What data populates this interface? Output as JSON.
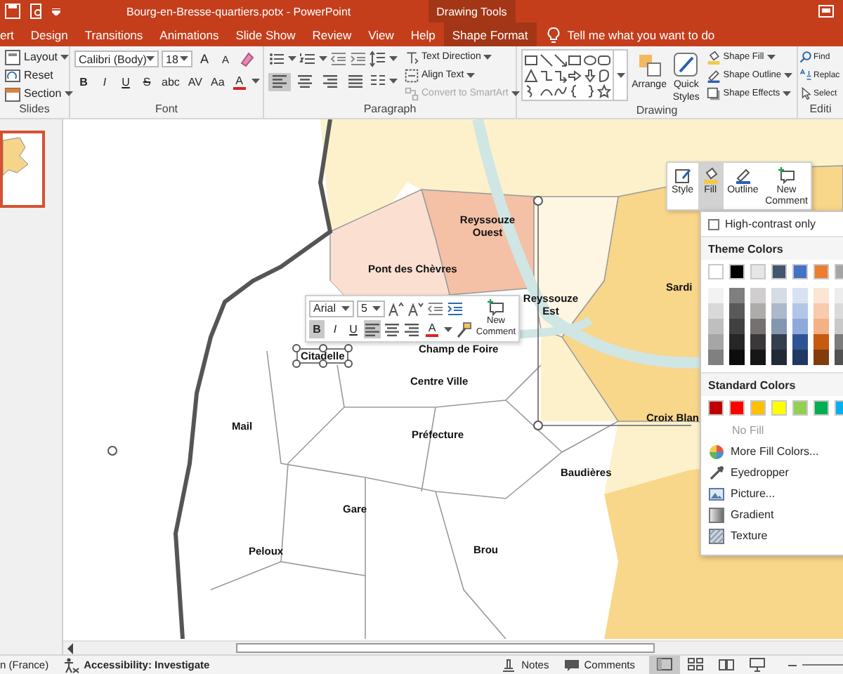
{
  "title_bar": {
    "title": "Bourg-en-Bresse-quartiers.potx  -  PowerPoint",
    "contextual_group": "Drawing Tools"
  },
  "tabs": [
    {
      "label": "ert",
      "selected": false
    },
    {
      "label": "Design",
      "selected": false
    },
    {
      "label": "Transitions",
      "selected": false
    },
    {
      "label": "Animations",
      "selected": false
    },
    {
      "label": "Slide Show",
      "selected": false
    },
    {
      "label": "Review",
      "selected": false
    },
    {
      "label": "View",
      "selected": false
    },
    {
      "label": "Help",
      "selected": false
    },
    {
      "label": "Shape Format",
      "selected": true
    }
  ],
  "tell_me": {
    "placeholder": "Tell me what you want to do"
  },
  "ribbon": {
    "slides_group": {
      "label": "Slides",
      "buttons": [
        {
          "kind": "layout",
          "label": "Layout"
        },
        {
          "kind": "reset",
          "label": "Reset"
        },
        {
          "kind": "section",
          "label": "Section"
        }
      ]
    },
    "font_group": {
      "label": "Font",
      "font": "Calibri (Body)",
      "size": "18",
      "size_buttons": [
        "A",
        "A"
      ],
      "style_buttons": [
        {
          "label": "B",
          "selected": false
        },
        {
          "label": "I",
          "selected": false
        },
        {
          "label": "U",
          "selected": false
        },
        {
          "label": "S",
          "selected": false
        },
        {
          "label": "abc",
          "selected": false
        },
        {
          "label": "AV",
          "selected": false
        },
        {
          "label": "Aa",
          "selected": false
        }
      ],
      "font_color_label": "A"
    },
    "paragraph_group": {
      "label": "Paragraph",
      "align_buttons": [
        {
          "kind": "left",
          "selected": true
        },
        {
          "kind": "center",
          "selected": false
        },
        {
          "kind": "right",
          "selected": false
        },
        {
          "kind": "justify",
          "selected": false
        }
      ],
      "commands": [
        {
          "kind": "text-direction",
          "label": "Text Direction",
          "disabled": false
        },
        {
          "kind": "align-text",
          "label": "Align Text",
          "disabled": false
        },
        {
          "kind": "smartart",
          "label": "Convert to SmartArt",
          "disabled": true
        }
      ]
    },
    "drawing_group": {
      "label": "Drawing",
      "arrange": "Arrange",
      "quick_styles": "Quick Styles",
      "commands": [
        {
          "kind": "fill",
          "label": "Shape Fill"
        },
        {
          "kind": "outline",
          "label": "Shape Outline"
        },
        {
          "kind": "effects",
          "label": "Shape Effects"
        }
      ]
    },
    "editing_group": {
      "label": "Editi",
      "commands": [
        {
          "kind": "find",
          "label": "Find"
        },
        {
          "kind": "replace",
          "label": "Replac"
        },
        {
          "kind": "select",
          "label": "Select"
        }
      ]
    }
  },
  "slide_thumbnails": [
    {
      "selected": true
    }
  ],
  "map_labels": [
    {
      "text": "Reyssouze Ouest",
      "selected": false
    },
    {
      "text": "Pont des Chèvres",
      "selected": false
    },
    {
      "text": "Reyssouze Est",
      "selected": false
    },
    {
      "text": "Sardi",
      "selected": false
    },
    {
      "text": "Citadelle",
      "selected": true
    },
    {
      "text": "Champ de Foire",
      "selected": false
    },
    {
      "text": "Centre Ville",
      "selected": false
    },
    {
      "text": "Mail",
      "selected": false
    },
    {
      "text": "Préfecture",
      "selected": false
    },
    {
      "text": "Croix Blan",
      "selected": false
    },
    {
      "text": "Baudières",
      "selected": false
    },
    {
      "text": "Gare",
      "selected": false
    },
    {
      "text": "Peloux",
      "selected": false
    },
    {
      "text": "Brou",
      "selected": false
    }
  ],
  "mini_toolbar": {
    "font": "Arial",
    "size": "5",
    "style_buttons": [
      {
        "label": "B",
        "selected": true
      },
      {
        "label": "I",
        "selected": false
      },
      {
        "label": "U",
        "selected": false
      }
    ],
    "align_buttons": [
      {
        "kind": "left",
        "selected": true
      },
      {
        "kind": "center",
        "selected": false
      },
      {
        "kind": "right",
        "selected": false
      }
    ],
    "font_color_label": "A",
    "new_comment": "New Comment"
  },
  "shape_toolbar": [
    {
      "kind": "style",
      "label": "Style",
      "selected": false
    },
    {
      "kind": "fill",
      "label": "Fill",
      "selected": true
    },
    {
      "kind": "outline",
      "label": "Outline",
      "selected": false
    },
    {
      "kind": "comment",
      "label": "New Comment",
      "selected": false
    }
  ],
  "fill_menu": {
    "high_contrast": {
      "label": "High-contrast only",
      "checked": false
    },
    "theme_header": "Theme Colors",
    "theme_colors": [
      {
        "color": "#ffffff",
        "shades": [
          {
            "color": "#f2f2f2"
          },
          {
            "color": "#d9d9d9"
          },
          {
            "color": "#bfbfbf"
          },
          {
            "color": "#a6a6a6"
          },
          {
            "color": "#808080"
          }
        ]
      },
      {
        "color": "#000000",
        "shades": [
          {
            "color": "#7f7f7f"
          },
          {
            "color": "#595959"
          },
          {
            "color": "#404040"
          },
          {
            "color": "#262626"
          },
          {
            "color": "#0d0d0d"
          }
        ]
      },
      {
        "color": "#e7e6e6",
        "shades": [
          {
            "color": "#d0cece"
          },
          {
            "color": "#aeabab"
          },
          {
            "color": "#757171"
          },
          {
            "color": "#3a3838"
          },
          {
            "color": "#171616"
          }
        ]
      },
      {
        "color": "#44546a",
        "shades": [
          {
            "color": "#d6dce4"
          },
          {
            "color": "#adb9ca"
          },
          {
            "color": "#8497b0"
          },
          {
            "color": "#333f4f"
          },
          {
            "color": "#222a35"
          }
        ]
      },
      {
        "color": "#4472c4",
        "shades": [
          {
            "color": "#d9e2f3"
          },
          {
            "color": "#b4c6e7"
          },
          {
            "color": "#8eaadb"
          },
          {
            "color": "#2f5496"
          },
          {
            "color": "#1f3864"
          }
        ]
      },
      {
        "color": "#ed7d31",
        "shades": [
          {
            "color": "#fbe5d5"
          },
          {
            "color": "#f7cbac"
          },
          {
            "color": "#f4b183"
          },
          {
            "color": "#c55a11"
          },
          {
            "color": "#833c0b"
          }
        ]
      },
      {
        "color": "#a5a5a5",
        "shades": [
          {
            "color": "#ededed"
          },
          {
            "color": "#dbdbdb"
          },
          {
            "color": "#c9c9c9"
          },
          {
            "color": "#7b7b7b"
          },
          {
            "color": "#525252"
          }
        ]
      }
    ],
    "standard_header": "Standard Colors",
    "standard_colors": [
      {
        "color": "#c00000"
      },
      {
        "color": "#ff0000"
      },
      {
        "color": "#ffc000"
      },
      {
        "color": "#ffff00"
      },
      {
        "color": "#92d050"
      },
      {
        "color": "#00b050"
      },
      {
        "color": "#00b0f0"
      }
    ],
    "items": [
      {
        "kind": "none",
        "label": "No Fill",
        "disabled": true
      },
      {
        "kind": "palette",
        "label": "More Fill Colors...",
        "disabled": false
      },
      {
        "kind": "eyedropper",
        "label": "Eyedropper",
        "disabled": false
      },
      {
        "kind": "picture",
        "label": "Picture...",
        "disabled": false
      },
      {
        "kind": "gradient",
        "label": "Gradient",
        "disabled": false
      },
      {
        "kind": "texture",
        "label": "Texture",
        "disabled": false
      }
    ]
  },
  "status_bar": {
    "language": "n (France)",
    "accessibility": "Accessibility: Investigate",
    "notes": "Notes",
    "comments": "Comments",
    "views": [
      {
        "kind": "normal",
        "selected": true
      },
      {
        "kind": "sorter",
        "selected": false
      },
      {
        "kind": "reading",
        "selected": false
      },
      {
        "kind": "slideshow",
        "selected": false
      }
    ]
  }
}
